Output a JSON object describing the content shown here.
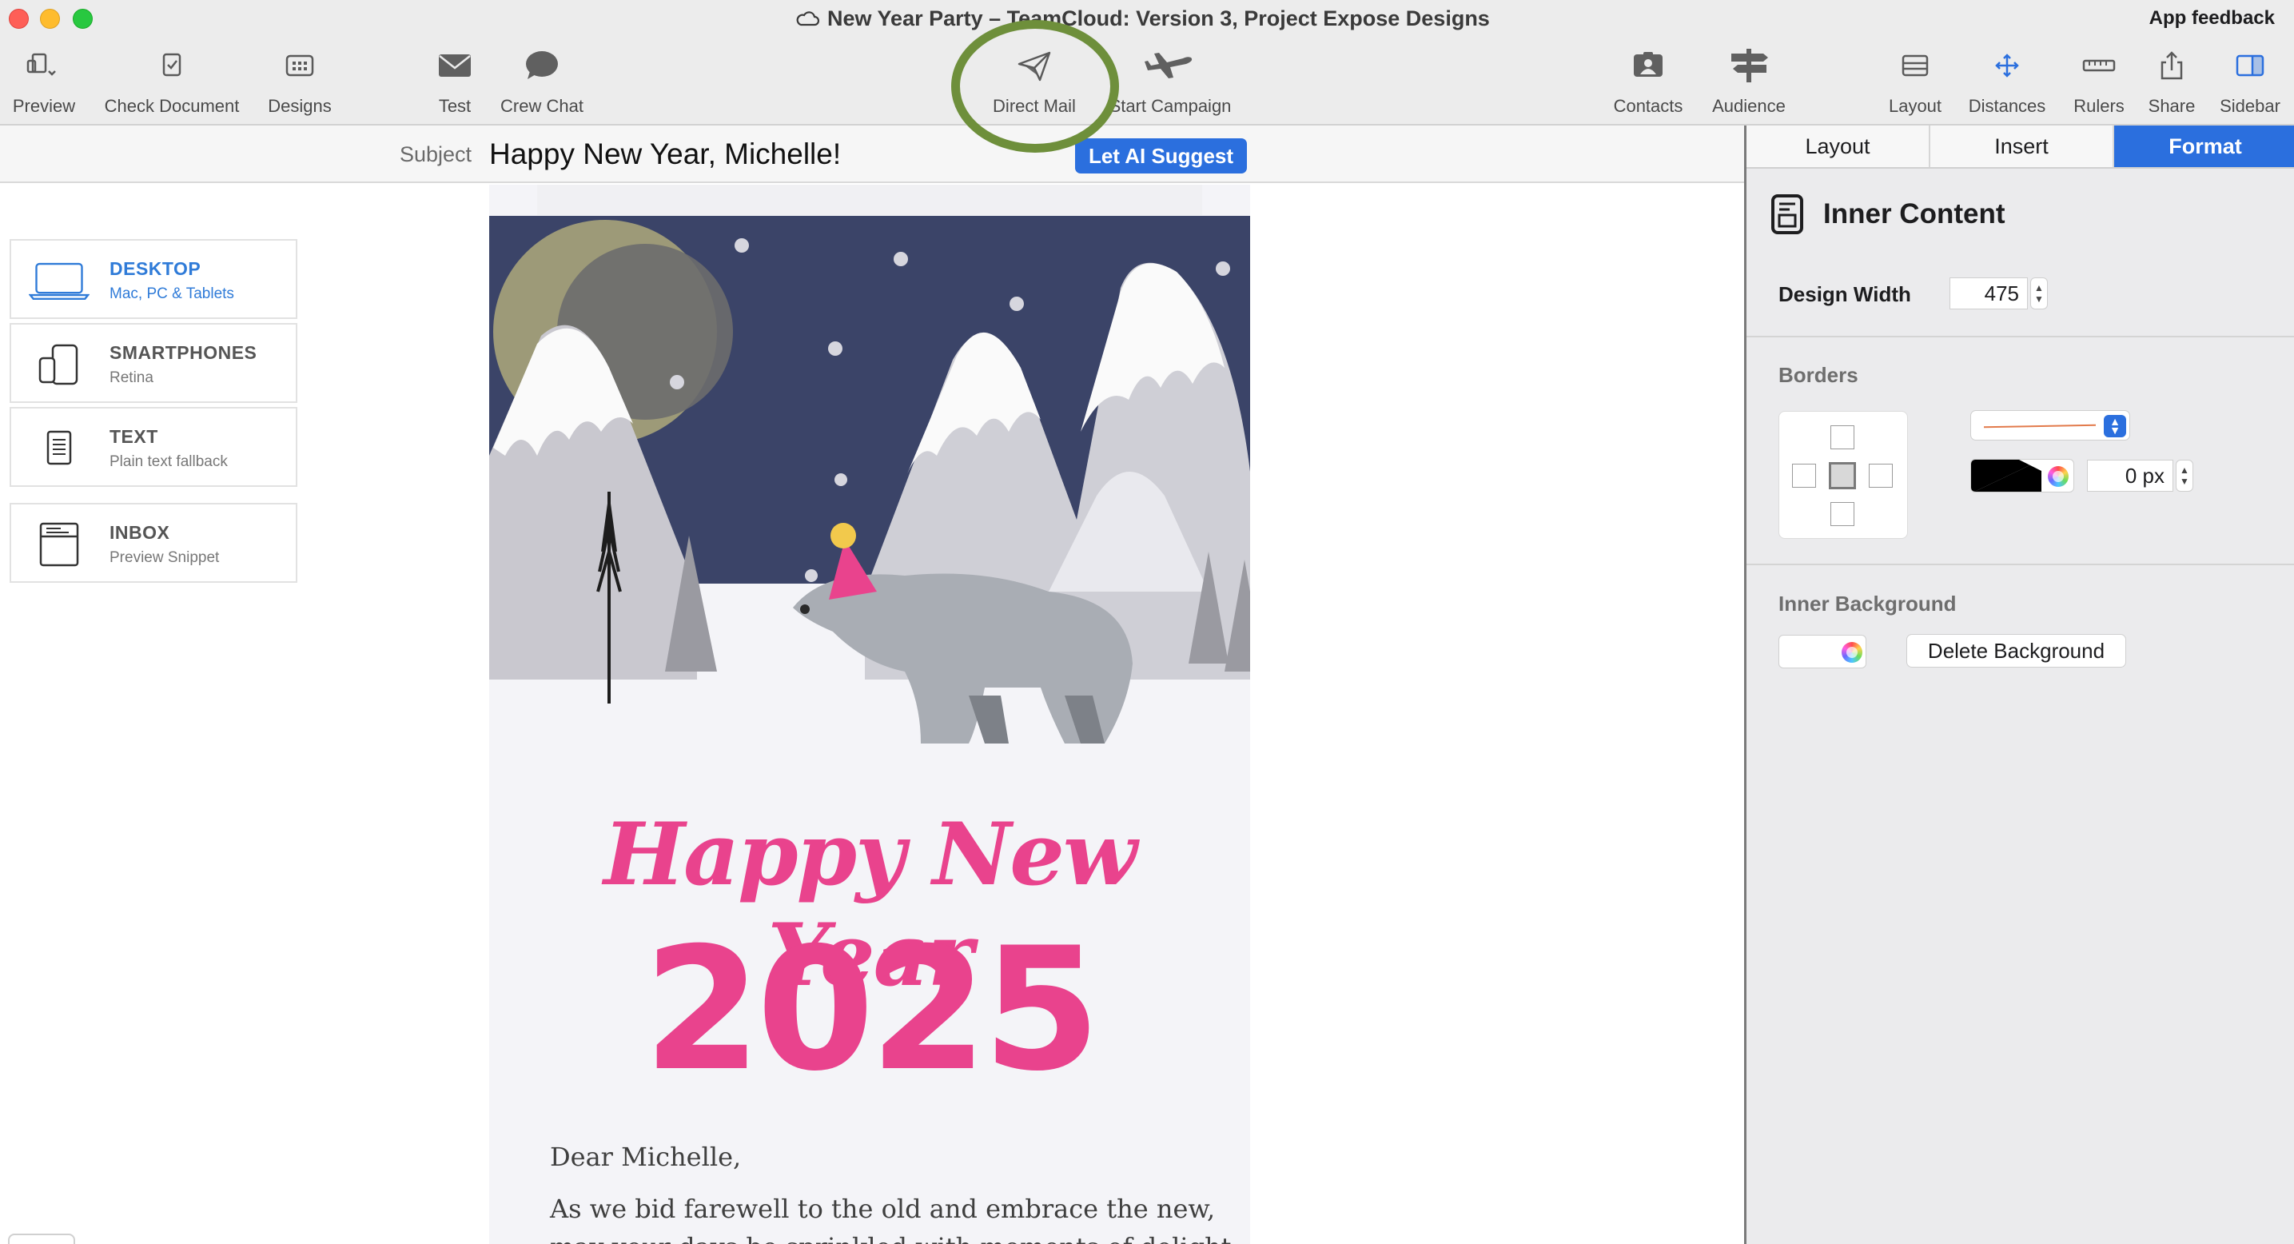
{
  "window": {
    "title": "New Year Party – TeamCloud: Version 3, Project  Expose Designs",
    "app_feedback": "App feedback"
  },
  "toolbar": {
    "items": [
      {
        "label": "Preview",
        "icon": "preview-icon"
      },
      {
        "label": "Check Document",
        "icon": "check-document-icon"
      },
      {
        "label": "Designs",
        "icon": "designs-icon"
      },
      {
        "label": "Test",
        "icon": "envelope-icon"
      },
      {
        "label": "Crew Chat",
        "icon": "chat-bubble-icon"
      },
      {
        "label": "Direct Mail",
        "icon": "paper-plane-icon"
      },
      {
        "label": "Start Campaign",
        "icon": "airplane-icon"
      },
      {
        "label": "Contacts",
        "icon": "contacts-icon"
      },
      {
        "label": "Audience",
        "icon": "signpost-icon"
      },
      {
        "label": "Layout",
        "icon": "layout-icon"
      },
      {
        "label": "Distances",
        "icon": "distances-icon"
      },
      {
        "label": "Rulers",
        "icon": "ruler-icon"
      },
      {
        "label": "Share",
        "icon": "share-icon"
      },
      {
        "label": "Sidebar",
        "icon": "sidebar-icon"
      }
    ]
  },
  "subject": {
    "label": "Subject",
    "value": "Happy New Year, Michelle!",
    "ai_button": "Let AI Suggest"
  },
  "devices": [
    {
      "title": "DESKTOP",
      "subtitle": "Mac, PC & Tablets",
      "icon": "laptop-icon",
      "active": true
    },
    {
      "title": "SMARTPHONES",
      "subtitle": "Retina",
      "icon": "smartphone-icon",
      "active": false
    },
    {
      "title": "TEXT",
      "subtitle": "Plain text fallback",
      "icon": "text-document-icon",
      "active": false
    },
    {
      "title": "INBOX",
      "subtitle": "Preview Snippet",
      "icon": "inbox-icon",
      "active": false
    }
  ],
  "email": {
    "headline": "Happy New Year",
    "year": "2025",
    "greeting": "Dear Michelle,",
    "body_line1": "As we bid farewell to the old and embrace the new,",
    "body_line2": "may your days be sprinkled with moments of delight,"
  },
  "sidebar": {
    "tabs": [
      "Layout",
      "Insert",
      "Format"
    ],
    "active_tab": "Format",
    "panel_title": "Inner Content",
    "design_width_label": "Design Width",
    "design_width_value": "475",
    "borders_label": "Borders",
    "border_width_value": "0 px",
    "inner_background_label": "Inner Background",
    "delete_background": "Delete Background"
  },
  "colors": {
    "accent": "#2b6fde",
    "pink": "#e9438d",
    "night_sky": "#3b4468",
    "highlight_ring": "#6e8f3b",
    "border_line": "#e27a4b"
  }
}
